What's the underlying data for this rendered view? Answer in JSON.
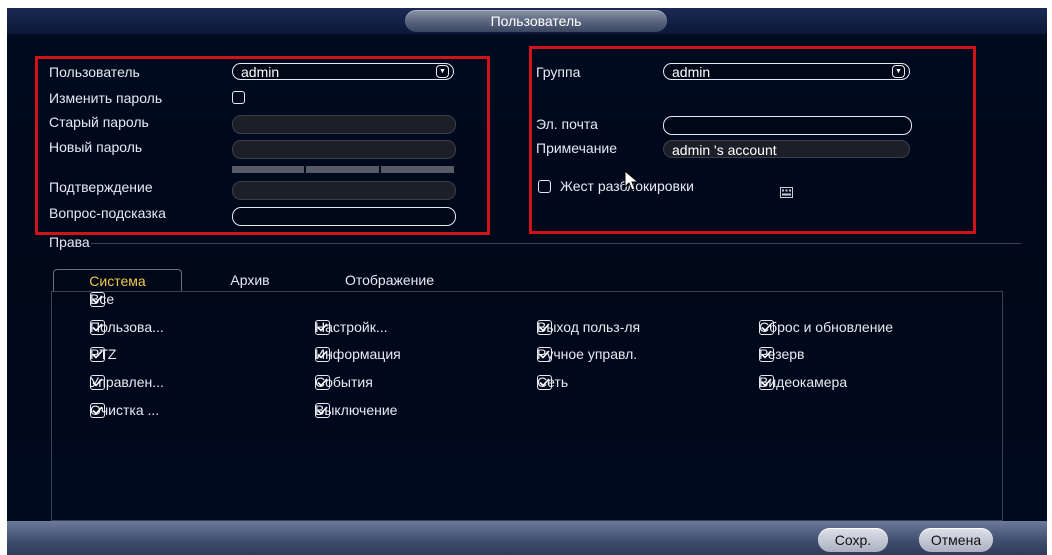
{
  "dialog": {
    "title": "Пользователь"
  },
  "left": {
    "user_label": "Пользователь",
    "user_value": "admin",
    "change_password_label": "Изменить пароль",
    "old_password_label": "Старый пароль",
    "new_password_label": "Новый пароль",
    "confirm_label": "Подтверждение",
    "hint_label": "Вопрос-подсказка"
  },
  "right": {
    "group_label": "Группа",
    "group_value": "admin",
    "email_label": "Эл. почта",
    "email_value": "",
    "note_label": "Примечание",
    "note_value": "admin 's account",
    "gesture_label": "Жест разблокировки"
  },
  "rights": {
    "section_label": "Права",
    "tabs": [
      "Система",
      "Архив",
      "Отображение"
    ],
    "all_label": "Все",
    "items": [
      "Пользова...",
      "Настройк...",
      "Выход польз-ля",
      "Сброс и обновление",
      "PTZ",
      "Информация",
      "Ручное управл.",
      "Резерв",
      "Управлен...",
      "События",
      "Сеть",
      "Видеокамера",
      "Очистка ...",
      "Выключение"
    ]
  },
  "buttons": {
    "save": "Сохр.",
    "cancel": "Отмена"
  },
  "colors": {
    "accent_tab": "#f2c84a",
    "highlight_box": "#d0121b",
    "background": "#000818"
  },
  "icons": [
    "chevron-down-icon",
    "check-icon",
    "keyboard-icon",
    "mouse-cursor-icon"
  ]
}
